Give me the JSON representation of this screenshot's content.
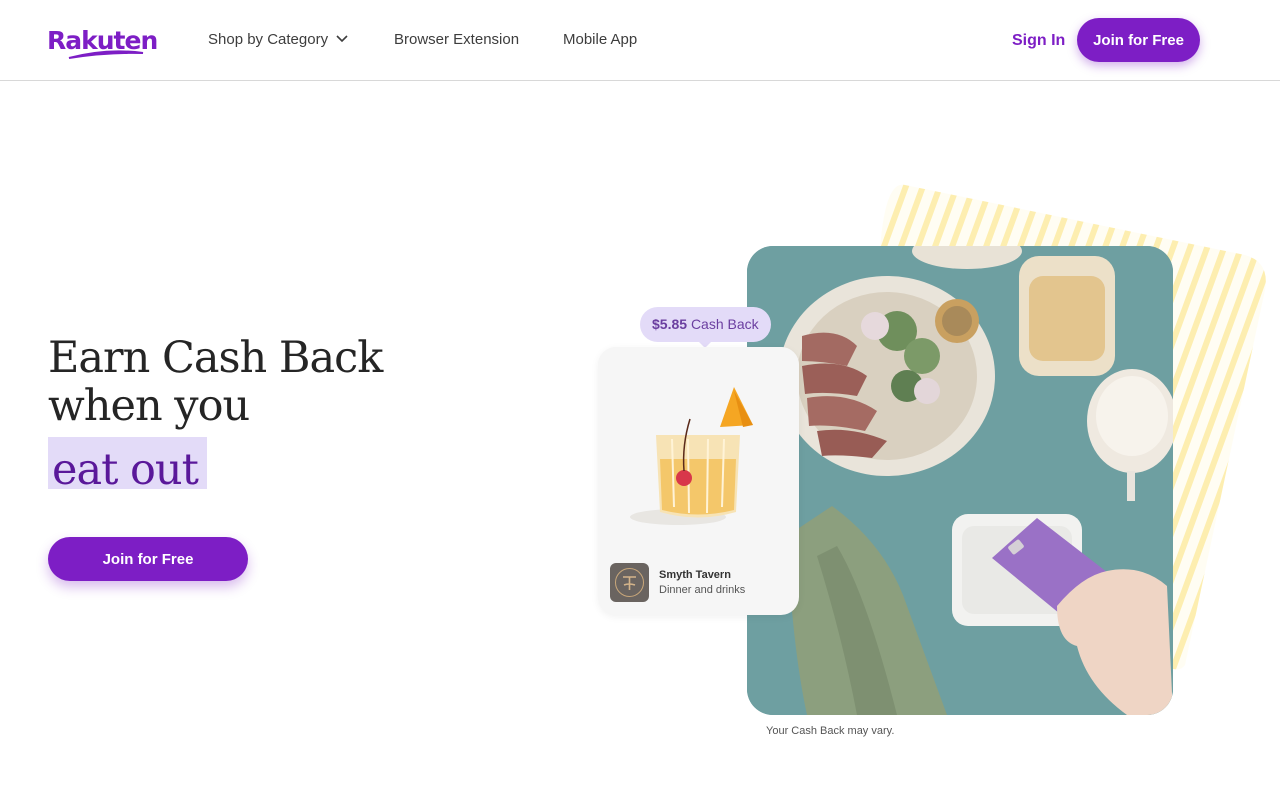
{
  "header": {
    "logo_text": "Rakuten",
    "nav": [
      {
        "label": "Shop by Category",
        "has_dropdown": true
      },
      {
        "label": "Browser Extension"
      },
      {
        "label": "Mobile App"
      }
    ],
    "sign_in_label": "Sign In",
    "join_label": "Join for Free"
  },
  "hero": {
    "headline_line1": "Earn Cash Back",
    "headline_line2": "when you",
    "highlight": "eat out",
    "cta_label": "Join for Free"
  },
  "promo_card": {
    "cashback_amount": "$5.85",
    "cashback_suffix": "Cash Back",
    "merchant_name": "Smyth Tavern",
    "merchant_desc": "Dinner and drinks"
  },
  "disclaimer": "Your Cash Back may vary.",
  "colors": {
    "brand": "#7d1ec5",
    "highlight_bg": "#e3dbf8",
    "highlight_text": "#5a189a",
    "stripe_yellow": "#fdeeb0"
  }
}
